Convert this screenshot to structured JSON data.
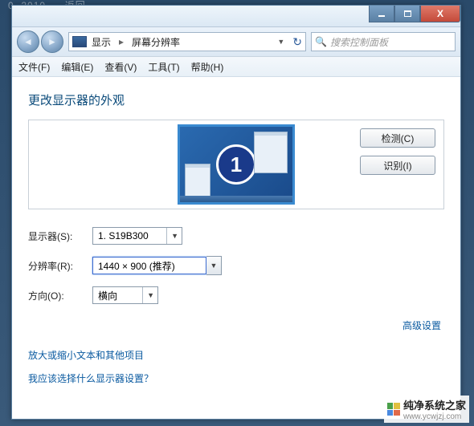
{
  "titlebar": {
    "min_tip": "minimize",
    "max_tip": "maximize",
    "close_tip": "close"
  },
  "address": {
    "icon_name": "display-icon",
    "crumb1": "显示",
    "crumb2": "屏幕分辨率"
  },
  "search": {
    "placeholder": "搜索控制面板"
  },
  "menu": {
    "file": "文件(F)",
    "edit": "编辑(E)",
    "view": "查看(V)",
    "tools": "工具(T)",
    "help": "帮助(H)"
  },
  "page": {
    "title": "更改显示器的外观",
    "monitor_number": "1",
    "detect_btn": "检测(C)",
    "identify_btn": "识别(I)"
  },
  "form": {
    "monitor_label": "显示器(S):",
    "monitor_value": "1. S19B300",
    "resolution_label": "分辨率(R):",
    "resolution_value": "1440 × 900 (推荐)",
    "orientation_label": "方向(O):",
    "orientation_value": "横向"
  },
  "links": {
    "advanced": "高级设置",
    "text_size": "放大或缩小文本和其他项目",
    "which_monitor": "我应该选择什么显示器设置？"
  },
  "watermark": {
    "text": "纯净系统之家",
    "url": "www.ycwjzj.com"
  }
}
